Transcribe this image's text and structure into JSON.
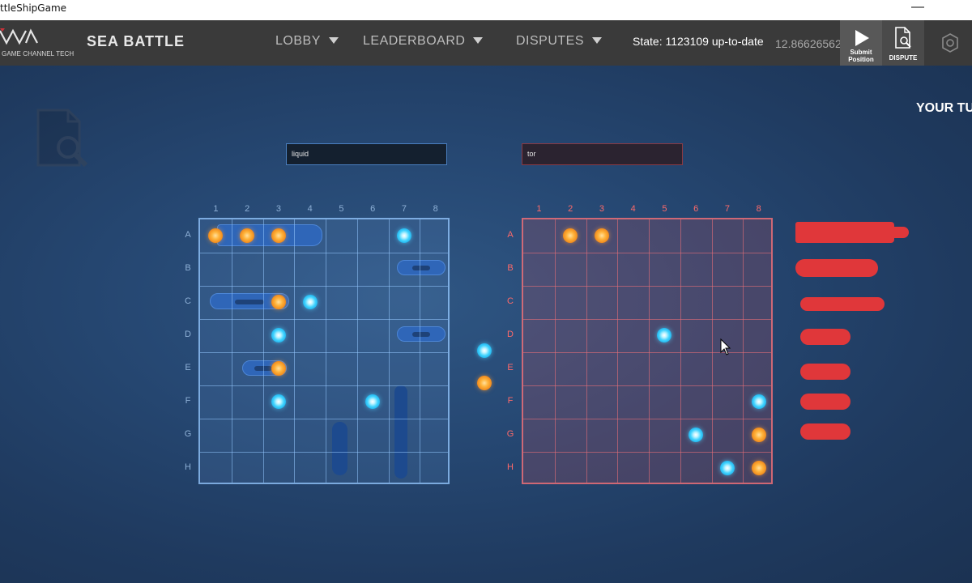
{
  "window": {
    "title": "ttleShipGame",
    "minimize": "—"
  },
  "header": {
    "logo_tagline": "GAME CHANNEL TECH",
    "brand": "SEA BATTLE",
    "nav": [
      "LOBBY",
      "LEADERBOARD",
      "DISPUTES"
    ],
    "state": "State: 1123109 up-to-date",
    "balance": "12.86626562",
    "submit_label_1": "Submit",
    "submit_label_2": "Position",
    "dispute_label": "DISPUTE"
  },
  "game": {
    "turn_text": "YOUR TU",
    "player_left": "liquid",
    "player_right": "tor",
    "columns": [
      "1",
      "2",
      "3",
      "4",
      "5",
      "6",
      "7",
      "8"
    ],
    "rows": [
      "A",
      "B",
      "C",
      "D",
      "E",
      "F",
      "G",
      "H"
    ],
    "left_board_pegs": [
      {
        "row": "A",
        "col": 1,
        "type": "hit"
      },
      {
        "row": "A",
        "col": 2,
        "type": "hit"
      },
      {
        "row": "A",
        "col": 3,
        "type": "hit"
      },
      {
        "row": "A",
        "col": 7,
        "type": "miss"
      },
      {
        "row": "C",
        "col": 3,
        "type": "hit"
      },
      {
        "row": "C",
        "col": 4,
        "type": "miss"
      },
      {
        "row": "D",
        "col": 3,
        "type": "miss"
      },
      {
        "row": "E",
        "col": 3,
        "type": "hit"
      },
      {
        "row": "F",
        "col": 3,
        "type": "miss"
      },
      {
        "row": "F",
        "col": 6,
        "type": "miss"
      }
    ],
    "right_board_pegs": [
      {
        "row": "A",
        "col": 2,
        "type": "hit"
      },
      {
        "row": "A",
        "col": 3,
        "type": "hit"
      },
      {
        "row": "D",
        "col": 5,
        "type": "miss"
      },
      {
        "row": "F",
        "col": 8,
        "type": "miss"
      },
      {
        "row": "G",
        "col": 6,
        "type": "miss"
      },
      {
        "row": "G",
        "col": 8,
        "type": "hit"
      },
      {
        "row": "H",
        "col": 7,
        "type": "miss"
      },
      {
        "row": "H",
        "col": 8,
        "type": "hit"
      }
    ],
    "legend_pegs": [
      "miss",
      "hit"
    ],
    "enemy_fleet": [
      "carrier",
      "battleship",
      "submarine",
      "patrol-boat",
      "patrol-boat",
      "patrol-boat",
      "patrol-boat"
    ],
    "colors": {
      "player": "#2f66b8",
      "opponent": "#e0373a",
      "miss": "#3fd3ff",
      "hit": "#f08a1c"
    }
  }
}
